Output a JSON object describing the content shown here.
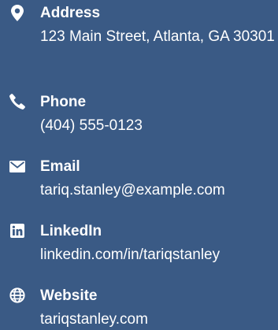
{
  "contacts": [
    {
      "icon": "map-marker-icon",
      "label": "Address",
      "value": "123 Main Street, Atlanta, GA 30301"
    },
    {
      "icon": "phone-icon",
      "label": "Phone",
      "value": "(404) 555-0123"
    },
    {
      "icon": "envelope-icon",
      "label": "Email",
      "value": "tariq.stanley@example.com"
    },
    {
      "icon": "linkedin-icon",
      "label": "LinkedIn",
      "value": "linkedin.com/in/tariqstanley"
    },
    {
      "icon": "globe-icon",
      "label": "Website",
      "value": "tariqstanley.com"
    }
  ],
  "colors": {
    "background": "#3a5a85",
    "text": "#ffffff"
  }
}
